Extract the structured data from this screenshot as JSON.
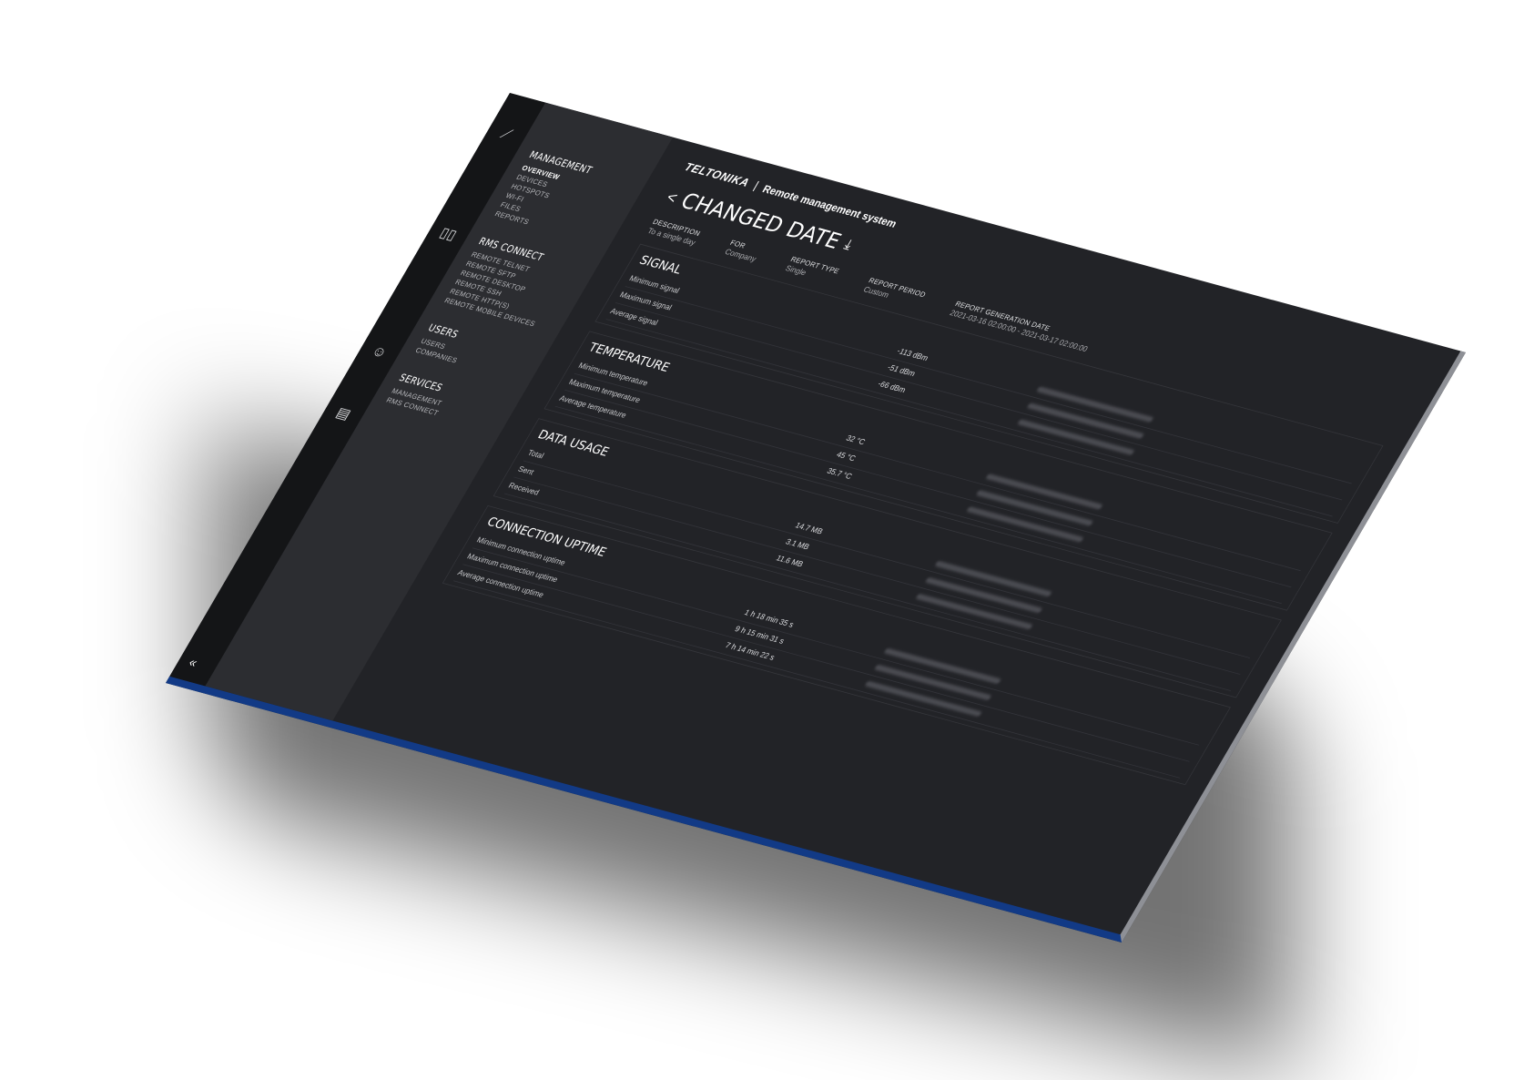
{
  "sidebar": {
    "groups": [
      {
        "title": "MANAGEMENT",
        "items": [
          "OVERVIEW",
          "DEVICES",
          "HOTSPOTS",
          "WI-FI",
          "FILES",
          "REPORTS"
        ]
      },
      {
        "title": "RMS CONNECT",
        "items": [
          "REMOTE TELNET",
          "REMOTE SFTP",
          "REMOTE DESKTOP",
          "REMOTE SSH",
          "REMOTE HTTP(S)",
          "REMOTE MOBILE DEVICES"
        ]
      },
      {
        "title": "USERS",
        "items": [
          "USERS",
          "COMPANIES"
        ]
      },
      {
        "title": "SERVICES",
        "items": [
          "MANAGEMENT",
          "RMS CONNECT"
        ]
      }
    ],
    "collapse_label": "«"
  },
  "rail_icons": [
    "chart-icon",
    "dashboard-icon",
    "users-icon",
    "document-icon"
  ],
  "brand": {
    "logo": "TELTONIKA",
    "separator": "|",
    "subtitle": "Remote management system"
  },
  "page": {
    "title": "CHANGED DATE",
    "back": "<",
    "download": "⤓"
  },
  "meta": [
    {
      "label": "DESCRIPTION",
      "value": "To a single day"
    },
    {
      "label": "FOR",
      "value": "Company"
    },
    {
      "label": "REPORT TYPE",
      "value": "Single"
    },
    {
      "label": "REPORT PERIOD",
      "value": "Custom"
    },
    {
      "label": "REPORT GENERATION DATE",
      "value": "2021-03-16 02:00:00 - 2021-03-17 02:00:00"
    }
  ],
  "sections": [
    {
      "title": "SIGNAL",
      "rows": [
        {
          "label": "Minimum signal",
          "value": "-113 dBm"
        },
        {
          "label": "Maximum signal",
          "value": "-51 dBm"
        },
        {
          "label": "Average signal",
          "value": "-66 dBm"
        }
      ]
    },
    {
      "title": "TEMPERATURE",
      "rows": [
        {
          "label": "Minimum temperature",
          "value": "32 °C"
        },
        {
          "label": "Maximum temperature",
          "value": "45 °C"
        },
        {
          "label": "Average temperature",
          "value": "35.7 °C"
        }
      ]
    },
    {
      "title": "DATA USAGE",
      "rows": [
        {
          "label": "Total",
          "value": "14.7 MB"
        },
        {
          "label": "Sent",
          "value": "3.1 MB"
        },
        {
          "label": "Received",
          "value": "11.6 MB"
        }
      ]
    },
    {
      "title": "CONNECTION UPTIME",
      "rows": [
        {
          "label": "Minimum connection uptime",
          "value": "1 h 18 min 35 s"
        },
        {
          "label": "Maximum connection uptime",
          "value": "9 h 15 min 31 s"
        },
        {
          "label": "Average connection uptime",
          "value": "7 h 14 min 22 s"
        }
      ]
    }
  ],
  "colors": {
    "background": "#222327",
    "sidebar": "#2c2d31",
    "rail": "#141517",
    "accent_edge": "#123a86"
  }
}
